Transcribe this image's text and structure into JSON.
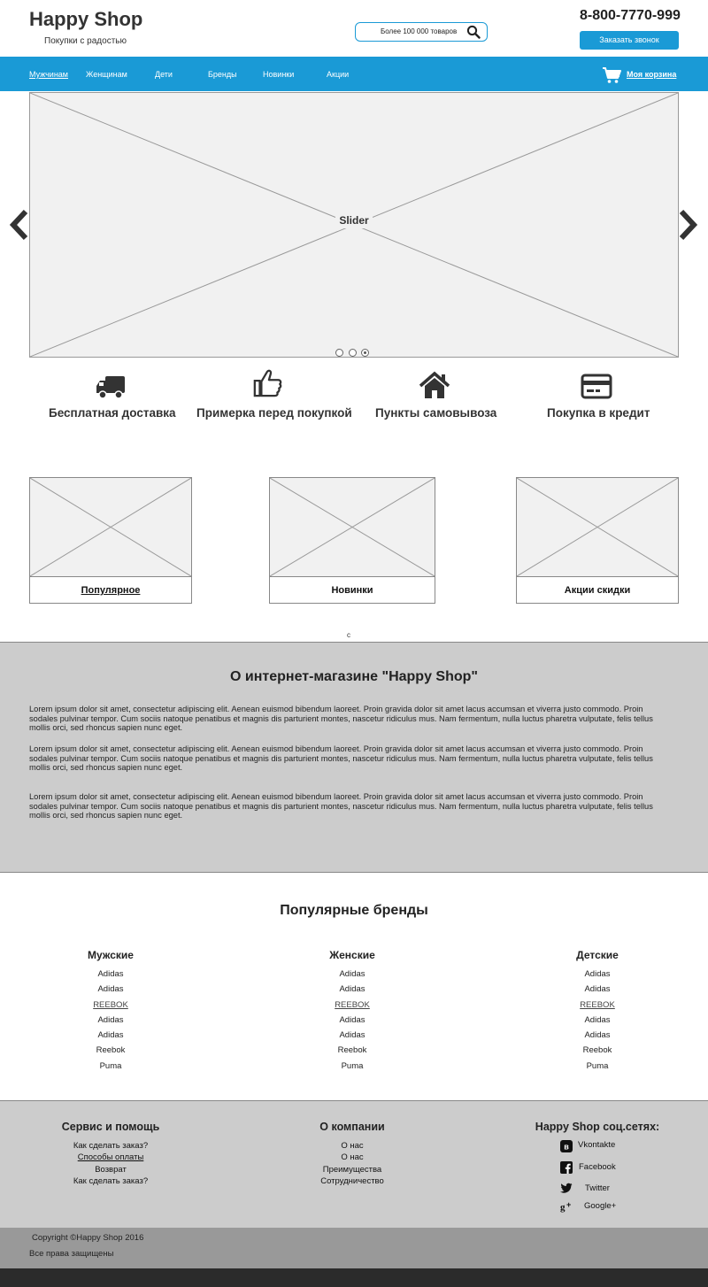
{
  "header": {
    "logo_title": "Happy Shop",
    "logo_subtitle": "Покупки с радостью",
    "search_text": "Более 100 000 товаров",
    "phone": "8-800-7770-999",
    "callback_label": "Заказать звонок"
  },
  "nav": {
    "items": [
      {
        "label": "Мужчинам",
        "active": true
      },
      {
        "label": "Женщинам",
        "active": false
      },
      {
        "label": "Дети",
        "active": false
      },
      {
        "label": "Бренды",
        "active": false
      },
      {
        "label": "Новинки",
        "active": false
      },
      {
        "label": "Акции",
        "active": false
      }
    ],
    "cart_label": "Моя корзина"
  },
  "slider": {
    "label": "Slider",
    "dots": 3,
    "active_dot": 3
  },
  "features": [
    {
      "icon": "truck-icon",
      "label": "Бесплатная доставка"
    },
    {
      "icon": "thumbs-up-icon",
      "label": "Примерка перед покупкой"
    },
    {
      "icon": "home-icon",
      "label": "Пункты самовывоза"
    },
    {
      "icon": "credit-card-icon",
      "label": "Покупка в кредит"
    }
  ],
  "categories": [
    {
      "label": "Популярное",
      "link": true
    },
    {
      "label": "Новинки",
      "link": false
    },
    {
      "label": "Акции скидки",
      "link": false
    }
  ],
  "stray_text": "c",
  "about": {
    "title": "О интернет-магазине \"Happy Shop\"",
    "paragraphs": [
      "Lorem ipsum dolor sit amet, consectetur adipiscing elit. Aenean euismod bibendum laoreet. Proin gravida dolor sit amet lacus accumsan et viverra justo commodo. Proin sodales pulvinar tempor. Cum sociis natoque penatibus et magnis dis parturient montes, nascetur ridiculus mus. Nam fermentum, nulla luctus pharetra vulputate, felis tellus mollis orci, sed rhoncus sapien nunc eget.",
      "Lorem ipsum dolor sit amet, consectetur adipiscing elit. Aenean euismod bibendum laoreet. Proin gravida dolor sit amet lacus accumsan et viverra justo commodo. Proin sodales pulvinar tempor. Cum sociis natoque penatibus et magnis dis parturient montes, nascetur ridiculus mus. Nam fermentum, nulla luctus pharetra vulputate, felis tellus mollis orci, sed rhoncus sapien nunc eget.",
      "Lorem ipsum dolor sit amet, consectetur adipiscing elit. Aenean euismod bibendum laoreet. Proin gravida dolor sit amet lacus accumsan et viverra justo commodo. Proin sodales pulvinar tempor. Cum sociis natoque penatibus et magnis dis parturient montes, nascetur ridiculus mus. Nam fermentum, nulla luctus pharetra vulputate, felis tellus mollis orci, sed rhoncus sapien nunc eget."
    ]
  },
  "brands": {
    "title": "Популярные бренды",
    "columns": [
      {
        "heading": "Мужские",
        "items": [
          "Adidas",
          "Adidas",
          "REEBOK",
          "Adidas",
          "Adidas",
          "Reebok",
          "Puma"
        ]
      },
      {
        "heading": "Женские",
        "items": [
          "Adidas",
          "Adidas",
          "REEBOK",
          "Adidas",
          "Adidas",
          "Reebok",
          "Puma"
        ]
      },
      {
        "heading": "Детские",
        "items": [
          "Adidas",
          "Adidas",
          "REEBOK",
          "Adidas",
          "Adidas",
          "Reebok",
          "Puma"
        ]
      }
    ],
    "link_item_index": 2
  },
  "footer": {
    "service": {
      "heading": "Сервис и помощь",
      "items": [
        "Как сделать заказ?",
        "Способы оплаты",
        "Возврат",
        "Как сделать заказ?"
      ]
    },
    "company": {
      "heading": "О компании",
      "items": [
        "О нас",
        "О нас",
        "Преимущества",
        "Сотрудничество"
      ]
    },
    "social": {
      "heading": "Happy Shop  соц.сетях:",
      "items": [
        {
          "icon": "vk-icon",
          "label": "Vkontakte"
        },
        {
          "icon": "facebook-icon",
          "label": "Facebook"
        },
        {
          "icon": "twitter-icon",
          "label": "Twitter"
        },
        {
          "icon": "google-plus-icon",
          "label": "Google+"
        }
      ]
    },
    "copyright": "Copyright ©Happy Shop 2016",
    "rights": "Все права защищены"
  },
  "colors": {
    "accent": "#1a9ad6",
    "gray_bg": "#cccccc",
    "copy_bg": "#999999",
    "bottom_bg": "#2b2b2b",
    "placeholder": "#f1f1f1"
  }
}
